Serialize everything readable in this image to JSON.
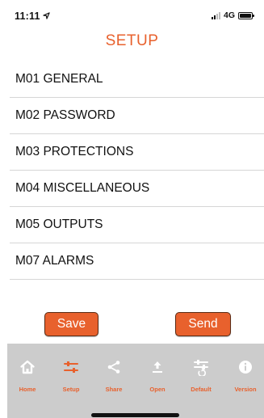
{
  "status": {
    "time": "11:11",
    "network": "4G"
  },
  "header": {
    "title": "SETUP"
  },
  "menu": {
    "items": [
      {
        "label": "M01 GENERAL"
      },
      {
        "label": "M02 PASSWORD"
      },
      {
        "label": "M03 PROTECTIONS"
      },
      {
        "label": "M04 MISCELLANEOUS"
      },
      {
        "label": "M05 OUTPUTS"
      },
      {
        "label": "M07 ALARMS"
      }
    ]
  },
  "actions": {
    "save_label": "Save",
    "send_label": "Send"
  },
  "tabbar": {
    "tabs": [
      {
        "label": "Home",
        "icon": "home-icon",
        "active": false
      },
      {
        "label": "Setup",
        "icon": "setup-sliders-icon",
        "active": true
      },
      {
        "label": "Share",
        "icon": "share-icon",
        "active": false
      },
      {
        "label": "Open",
        "icon": "upload-icon",
        "active": false
      },
      {
        "label": "Default",
        "icon": "restore-sliders-icon",
        "active": false
      },
      {
        "label": "Version",
        "icon": "info-icon",
        "active": false
      }
    ]
  },
  "colors": {
    "accent": "#e8612d",
    "tabbar_bg": "#cccccc",
    "icon_inactive": "#ffffff",
    "divider": "#d6d6d6"
  }
}
